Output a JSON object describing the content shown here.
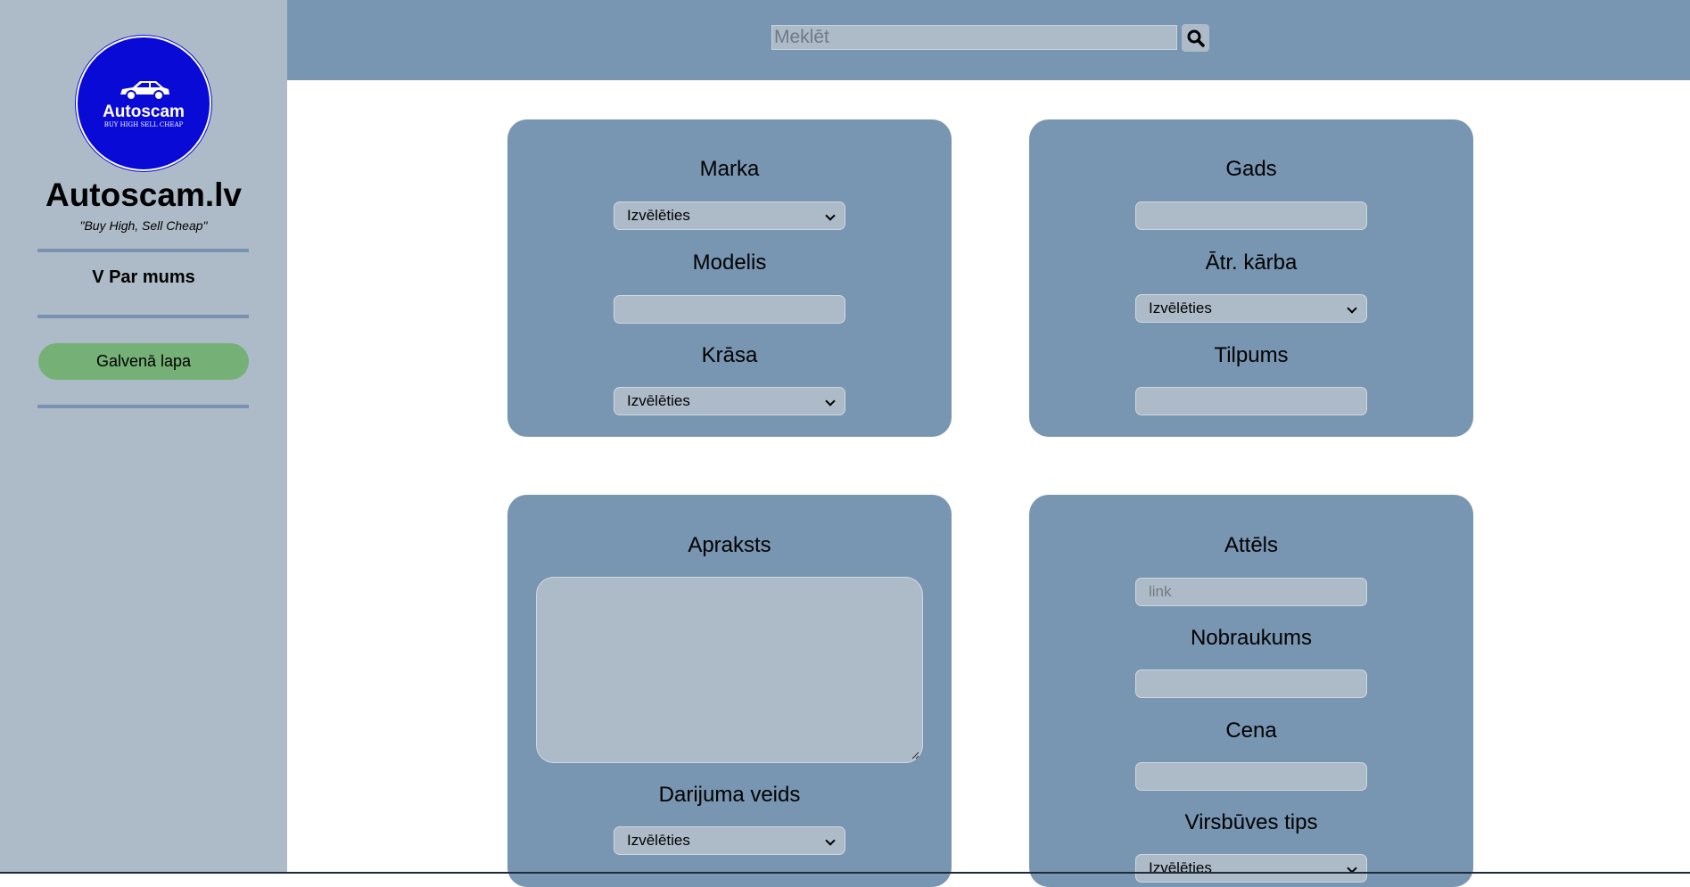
{
  "colors": {
    "sidebar": "#adbbc8",
    "topbar": "#7896b1",
    "panel": "#7896b1",
    "field": "#adbbc8",
    "logo": "#0a0ad6",
    "home_button": "#75b176"
  },
  "logo": {
    "name": "Autoscam",
    "tagline": "BUY HIGH SELL CHEAP",
    "icon": "car-icon"
  },
  "sidebar": {
    "title": "Autoscam.lv",
    "slogan": "\"Buy High, Sell Cheap\"",
    "about": "V Par mums",
    "home_button": "Galvenā lapa"
  },
  "search": {
    "placeholder": "Meklēt",
    "icon": "search-icon"
  },
  "panels": {
    "p1": {
      "marka": {
        "label": "Marka",
        "value": "Izvēlēties"
      },
      "modelis": {
        "label": "Modelis",
        "value": ""
      },
      "krasa": {
        "label": "Krāsa",
        "value": "Izvēlēties"
      }
    },
    "p2": {
      "gads": {
        "label": "Gads",
        "value": ""
      },
      "atr_karba": {
        "label": "Ātr. kārba",
        "value": "Izvēlēties"
      },
      "tilpums": {
        "label": "Tilpums",
        "value": ""
      }
    },
    "p3": {
      "apraksts": {
        "label": "Apraksts",
        "value": ""
      },
      "darijuma_veids": {
        "label": "Darijuma veids",
        "value": "Izvēlēties"
      }
    },
    "p4": {
      "attels": {
        "label": "Attēls",
        "placeholder": "link"
      },
      "nobraukums": {
        "label": "Nobraukums",
        "value": ""
      },
      "cena": {
        "label": "Cena",
        "value": ""
      },
      "virsbuves_tips": {
        "label": "Virsbūves tips",
        "value": "Izvēlēties"
      }
    }
  }
}
